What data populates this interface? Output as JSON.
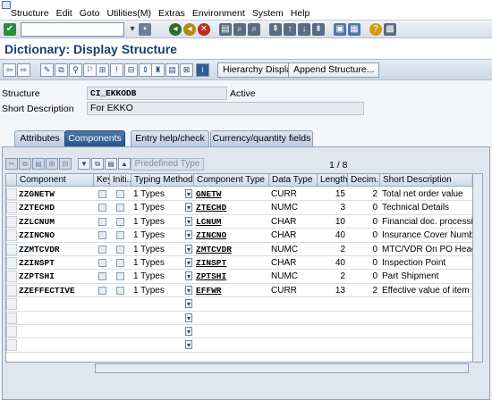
{
  "menubar": {
    "items": [
      "Structure",
      "Edit",
      "Goto",
      "Utilities(M)",
      "Extras",
      "Environment",
      "System",
      "Help"
    ]
  },
  "title": "Dictionary: Display Structure",
  "app_toolbar": {
    "hierarchy_label": "Hierarchy Display",
    "append_label": "Append Structure..."
  },
  "header": {
    "structure_label": "Structure",
    "structure_value": "CI_EKKODB",
    "status": "Active",
    "short_desc_label": "Short Description",
    "short_desc_value": "For EKKO"
  },
  "tabs": [
    {
      "label": "Attributes",
      "active": false
    },
    {
      "label": "Components",
      "active": true
    },
    {
      "label": "Entry help/check",
      "active": false
    },
    {
      "label": "Currency/quantity fields",
      "active": false
    }
  ],
  "table_toolbar": {
    "predefined_label": "Predefined Type",
    "pager": "1  /  8"
  },
  "table": {
    "headers": [
      "Component",
      "Key",
      "Initi...",
      "Typing Method",
      "Component Type",
      "Data Type",
      "Length",
      "Decim...",
      "Short Description"
    ],
    "rows": [
      {
        "component": "ZZGNETW",
        "typing": "1 Types",
        "comp_type": "GNETW",
        "data_type": "CURR",
        "length": "15",
        "decimals": "2",
        "desc": "Total net order value"
      },
      {
        "component": "ZZTECHD",
        "typing": "1 Types",
        "comp_type": "ZTECHD",
        "data_type": "NUMC",
        "length": "3",
        "decimals": "0",
        "desc": "Technical Details"
      },
      {
        "component": "ZZLCNUM",
        "typing": "1 Types",
        "comp_type": "LCNUM",
        "data_type": "CHAR",
        "length": "10",
        "decimals": "0",
        "desc": "Financial doc. processing:"
      },
      {
        "component": "ZZINCNO",
        "typing": "1 Types",
        "comp_type": "ZINCNO",
        "data_type": "CHAR",
        "length": "40",
        "decimals": "0",
        "desc": "Insurance Cover Number"
      },
      {
        "component": "ZZMTCVDR",
        "typing": "1 Types",
        "comp_type": "ZMTCVDR",
        "data_type": "NUMC",
        "length": "2",
        "decimals": "0",
        "desc": "MTC/VDR On PO Header"
      },
      {
        "component": "ZZINSPT",
        "typing": "1 Types",
        "comp_type": "ZINSPT",
        "data_type": "CHAR",
        "length": "40",
        "decimals": "0",
        "desc": "Inspection Point"
      },
      {
        "component": "ZZPTSHI",
        "typing": "1 Types",
        "comp_type": "ZPTSHI",
        "data_type": "NUMC",
        "length": "2",
        "decimals": "0",
        "desc": "Part Shipment"
      },
      {
        "component": "ZZEFFECTIVE",
        "typing": "1 Types",
        "comp_type": "EFFWR",
        "data_type": "CURR",
        "length": "13",
        "decimals": "2",
        "desc": "Effective value of item"
      }
    ]
  },
  "colors": {
    "title": "#1c3c6b",
    "tab_active": "#2b5487",
    "panel": "#dfe6ee"
  }
}
